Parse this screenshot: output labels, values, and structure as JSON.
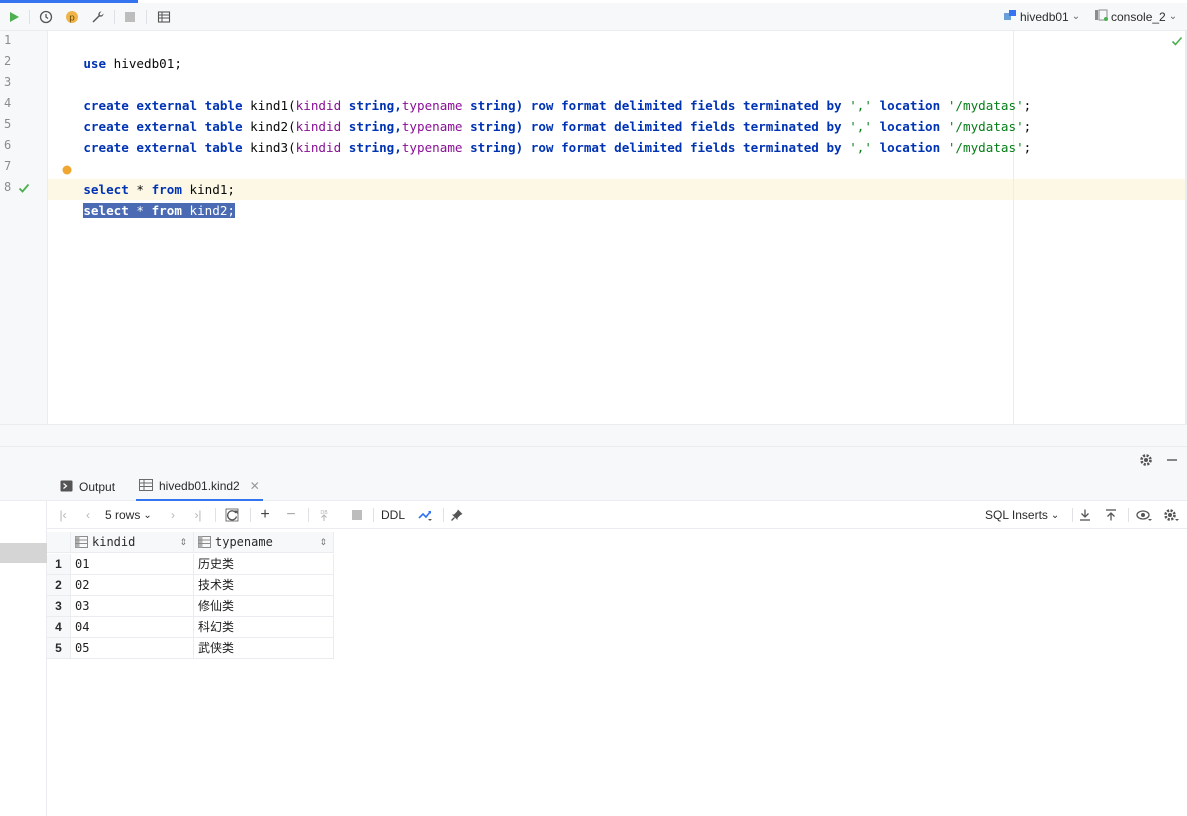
{
  "toolbar": {
    "datasource": "hivedb01",
    "session": "console_2",
    "colors": {
      "run": "#4caf50",
      "accent": "#3574f0"
    }
  },
  "editor": {
    "line_numbers": [
      "1",
      "2",
      "3",
      "4",
      "5",
      "6",
      "7",
      "8"
    ],
    "lines": {
      "l1": {
        "kw": "use",
        "rest": " hivedb01;"
      },
      "l3": {
        "a": "create external table",
        "b": " kind1(",
        "c": "kindid",
        "d": " string,",
        "e": "typename",
        "f": " string) ",
        "g": "row format delimited fields terminated by",
        "h": " ",
        "i": "','",
        "j": " ",
        "k": "location",
        "l": " ",
        "m": "'/mydatas'",
        "n": ";"
      },
      "l4": {
        "a": "create external table",
        "b": " kind2(",
        "c": "kindid",
        "d": " string,",
        "e": "typename",
        "f": " string) ",
        "g": "row format delimited fields terminated by",
        "h": " ",
        "i": "','",
        "j": " ",
        "k": "location",
        "l": " ",
        "m": "'/mydatas'",
        "n": ";"
      },
      "l5": {
        "a": "create external table",
        "b": " kind3(",
        "c": "kindid",
        "d": " string,",
        "e": "typename",
        "f": " string) ",
        "g": "row format delimited fields terminated by",
        "h": " ",
        "i": "','",
        "j": " ",
        "k": "location",
        "l": " ",
        "m": "'/mydatas'",
        "n": ";"
      },
      "l7": {
        "kw1": "select",
        "mid": " * ",
        "kw2": "from",
        "rest": " kind1;"
      },
      "l8": {
        "kw1": "select",
        "mid": " * ",
        "kw2": "from",
        "rest": " kind2;"
      }
    }
  },
  "results": {
    "tabs": {
      "output": "Output",
      "table": "hivedb01.kind2"
    },
    "rows_label": "5 rows",
    "ddl_label": "DDL",
    "export_label": "SQL Inserts",
    "columns": [
      "kindid",
      "typename"
    ],
    "rows": [
      {
        "n": "1",
        "kindid": "01",
        "typename": "历史类"
      },
      {
        "n": "2",
        "kindid": "02",
        "typename": "技术类"
      },
      {
        "n": "3",
        "kindid": "03",
        "typename": "修仙类"
      },
      {
        "n": "4",
        "kindid": "04",
        "typename": "科幻类"
      },
      {
        "n": "5",
        "kindid": "05",
        "typename": "武侠类"
      }
    ]
  }
}
